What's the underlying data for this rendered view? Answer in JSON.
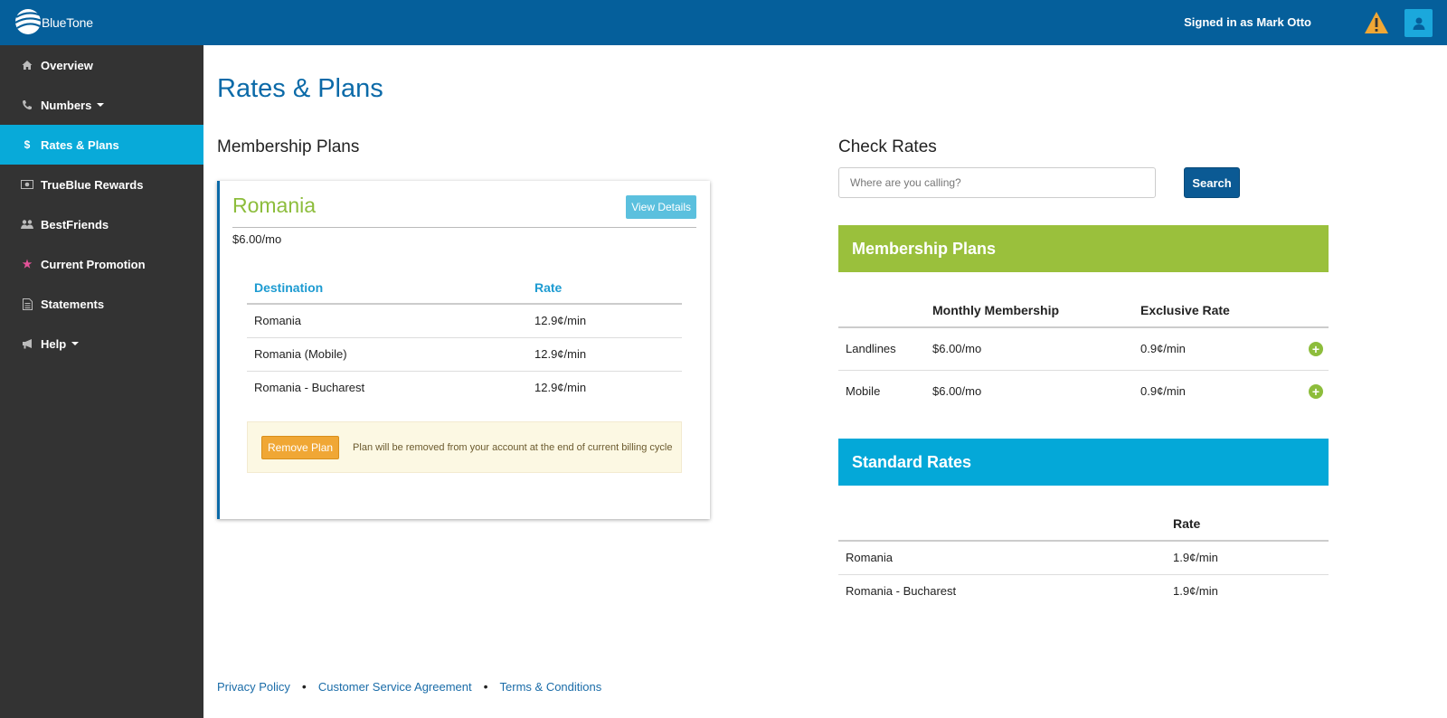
{
  "header": {
    "brand": "BlueTone",
    "signed_in": "Signed in as Mark Otto",
    "icons": {
      "warning": "warning-icon",
      "user": "user-icon"
    },
    "colors": {
      "bar": "#055f9b",
      "accent": "#08aad9",
      "warning": "#f0a735"
    }
  },
  "sidebar": {
    "items": [
      {
        "label": "Overview",
        "icon": "home-icon"
      },
      {
        "label": "Numbers",
        "icon": "phone-icon"
      },
      {
        "label": "Rates & Plans",
        "icon": "dollar-icon"
      },
      {
        "label": "TrueBlue Rewards",
        "icon": "money-icon"
      },
      {
        "label": "BestFriends",
        "icon": "group-icon"
      },
      {
        "label": "Current Promotion",
        "icon": "star-icon"
      },
      {
        "label": "Statements",
        "icon": "document-icon"
      },
      {
        "label": "Help",
        "icon": "megaphone-icon"
      }
    ],
    "active": "Rates & Plans"
  },
  "main": {
    "title": "Rates & Plans",
    "membership_heading": "Membership Plans",
    "check_rates_heading": "Check Rates"
  },
  "plan": {
    "name": "Romania",
    "view_details": "View Details",
    "price": "$6.00/mo",
    "table": {
      "headers": [
        "Destination",
        "Rate"
      ],
      "rows": [
        [
          "Romania",
          "12.9¢/min"
        ],
        [
          "Romania (Mobile)",
          "12.9¢/min"
        ],
        [
          "Romania - Bucharest",
          "12.9¢/min"
        ]
      ]
    },
    "remove_button": "Remove Plan",
    "remove_notice": "Plan will be removed from your account at the end of current billing cycle"
  },
  "check_rates": {
    "placeholder": "Where are you calling?",
    "search_button": "Search"
  },
  "membership_plans": {
    "title": "Membership Plans",
    "headers": [
      "",
      "Monthly Membership",
      "Exclusive Rate"
    ],
    "rows": [
      [
        "Landlines",
        "$6.00/mo",
        "0.9¢/min"
      ],
      [
        "Mobile",
        "$6.00/mo",
        "0.9¢/min"
      ]
    ],
    "add_icon": "plus-circle-icon"
  },
  "standard_rates": {
    "title": "Standard Rates",
    "headers": [
      "",
      "Rate"
    ],
    "rows": [
      [
        "Romania",
        "1.9¢/min"
      ],
      [
        "Romania - Bucharest",
        "1.9¢/min"
      ]
    ]
  },
  "footer": {
    "links": [
      "Privacy Policy",
      "Customer Service Agreement",
      "Terms & Conditions"
    ]
  }
}
